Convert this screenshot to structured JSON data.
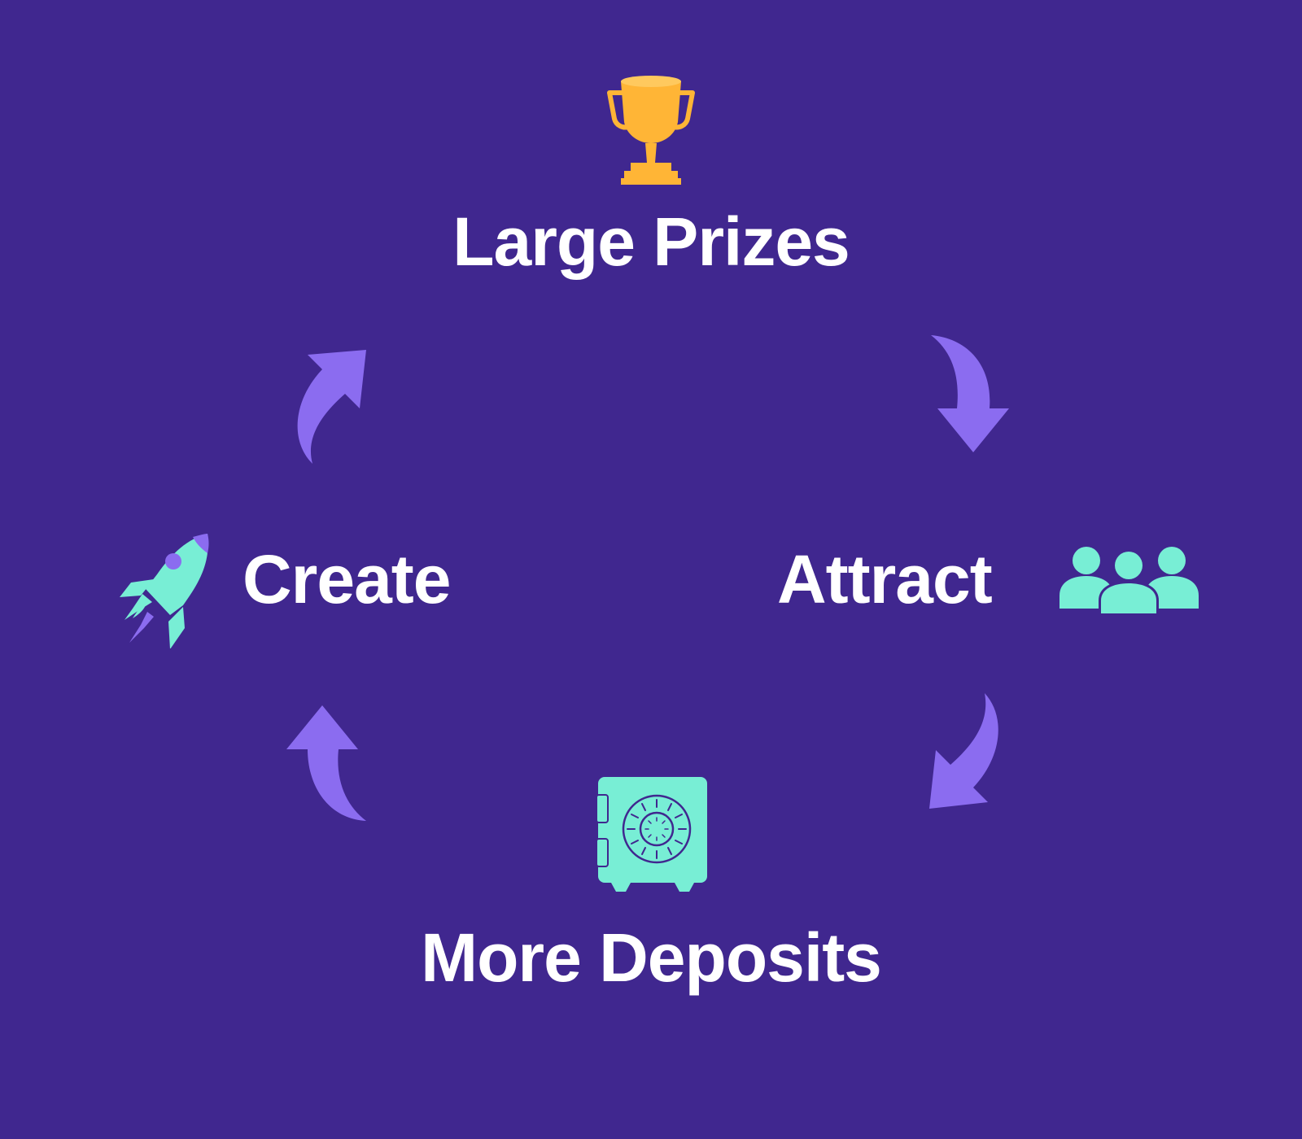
{
  "nodes": {
    "top": "Large Prizes",
    "right": "Attract",
    "bottom": "More Deposits",
    "left": "Create"
  },
  "colors": {
    "background": "#40278f",
    "arrow": "#8b6cf0",
    "trophy": "#ffb536",
    "icon_teal": "#78eed5",
    "text": "#ffffff"
  },
  "icons": {
    "top": "trophy-icon",
    "right": "people-group-icon",
    "bottom": "safe-vault-icon",
    "left": "rocket-icon"
  }
}
